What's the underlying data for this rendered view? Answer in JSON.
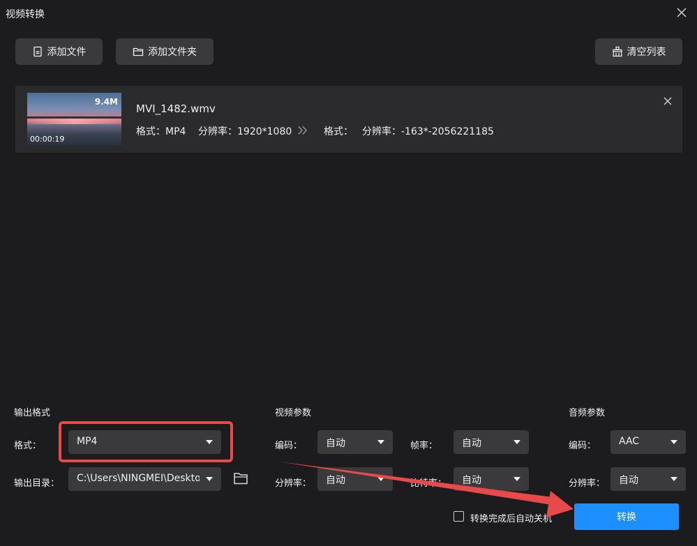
{
  "window": {
    "title": "视频转换",
    "close_icon": "close-icon"
  },
  "toolbar": {
    "add_file": "添加文件",
    "add_folder": "添加文件夹",
    "clear_list": "清空列表"
  },
  "file": {
    "name": "MVI_1482.wmv",
    "size": "9.4M",
    "duration": "00:00:19",
    "source_format_label": "格式：MP4",
    "source_resolution_label": "分辨率：1920*1080",
    "target_format_label": "格式：",
    "target_resolution_label": "分辨率：-163*-2056221185"
  },
  "output_format": {
    "section_title": "输出格式",
    "format_label": "格式：",
    "format_value": "MP4",
    "dir_label": "输出目录：",
    "dir_value": "C:\\Users\\NINGMEI\\Desktop"
  },
  "video_params": {
    "section_title": "视频参数",
    "codec_label": "编码：",
    "codec_value": "自动",
    "fps_label": "帧率：",
    "fps_value": "自动",
    "resolution_label": "分辨率：",
    "resolution_value": "自动",
    "bitrate_label": "比特率：",
    "bitrate_value": "自动"
  },
  "audio_params": {
    "section_title": "音频参数",
    "codec_label": "编码：",
    "codec_value": "AAC",
    "resolution_label": "分辨率：",
    "resolution_value": "自动"
  },
  "footer": {
    "shutdown_label": "转换完成后自动关机",
    "convert_button": "转换"
  },
  "colors": {
    "background": "#1c1c1e",
    "panel": "#2b2b2d",
    "control": "#3a3a3d",
    "accent": "#1e8fff",
    "annotation": "#e84a4a"
  }
}
